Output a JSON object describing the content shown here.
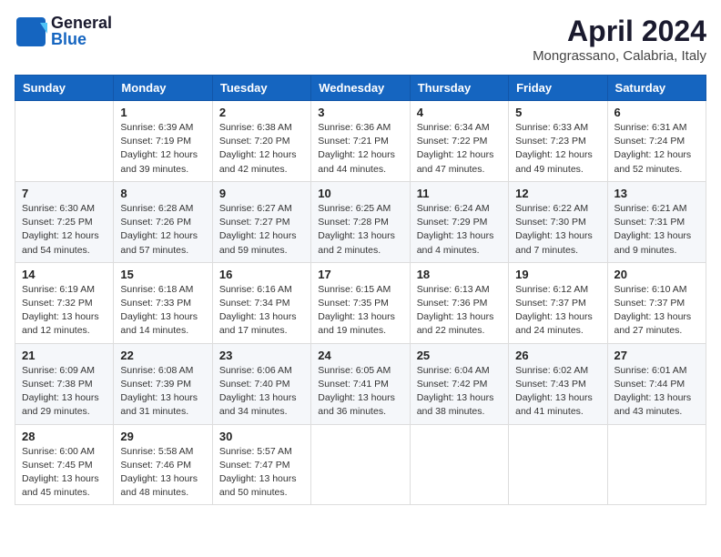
{
  "header": {
    "logo_line1": "General",
    "logo_line2": "Blue",
    "month": "April 2024",
    "location": "Mongrassano, Calabria, Italy"
  },
  "days_of_week": [
    "Sunday",
    "Monday",
    "Tuesday",
    "Wednesday",
    "Thursday",
    "Friday",
    "Saturday"
  ],
  "weeks": [
    [
      {
        "day": "",
        "info": ""
      },
      {
        "day": "1",
        "info": "Sunrise: 6:39 AM\nSunset: 7:19 PM\nDaylight: 12 hours\nand 39 minutes."
      },
      {
        "day": "2",
        "info": "Sunrise: 6:38 AM\nSunset: 7:20 PM\nDaylight: 12 hours\nand 42 minutes."
      },
      {
        "day": "3",
        "info": "Sunrise: 6:36 AM\nSunset: 7:21 PM\nDaylight: 12 hours\nand 44 minutes."
      },
      {
        "day": "4",
        "info": "Sunrise: 6:34 AM\nSunset: 7:22 PM\nDaylight: 12 hours\nand 47 minutes."
      },
      {
        "day": "5",
        "info": "Sunrise: 6:33 AM\nSunset: 7:23 PM\nDaylight: 12 hours\nand 49 minutes."
      },
      {
        "day": "6",
        "info": "Sunrise: 6:31 AM\nSunset: 7:24 PM\nDaylight: 12 hours\nand 52 minutes."
      }
    ],
    [
      {
        "day": "7",
        "info": "Sunrise: 6:30 AM\nSunset: 7:25 PM\nDaylight: 12 hours\nand 54 minutes."
      },
      {
        "day": "8",
        "info": "Sunrise: 6:28 AM\nSunset: 7:26 PM\nDaylight: 12 hours\nand 57 minutes."
      },
      {
        "day": "9",
        "info": "Sunrise: 6:27 AM\nSunset: 7:27 PM\nDaylight: 12 hours\nand 59 minutes."
      },
      {
        "day": "10",
        "info": "Sunrise: 6:25 AM\nSunset: 7:28 PM\nDaylight: 13 hours\nand 2 minutes."
      },
      {
        "day": "11",
        "info": "Sunrise: 6:24 AM\nSunset: 7:29 PM\nDaylight: 13 hours\nand 4 minutes."
      },
      {
        "day": "12",
        "info": "Sunrise: 6:22 AM\nSunset: 7:30 PM\nDaylight: 13 hours\nand 7 minutes."
      },
      {
        "day": "13",
        "info": "Sunrise: 6:21 AM\nSunset: 7:31 PM\nDaylight: 13 hours\nand 9 minutes."
      }
    ],
    [
      {
        "day": "14",
        "info": "Sunrise: 6:19 AM\nSunset: 7:32 PM\nDaylight: 13 hours\nand 12 minutes."
      },
      {
        "day": "15",
        "info": "Sunrise: 6:18 AM\nSunset: 7:33 PM\nDaylight: 13 hours\nand 14 minutes."
      },
      {
        "day": "16",
        "info": "Sunrise: 6:16 AM\nSunset: 7:34 PM\nDaylight: 13 hours\nand 17 minutes."
      },
      {
        "day": "17",
        "info": "Sunrise: 6:15 AM\nSunset: 7:35 PM\nDaylight: 13 hours\nand 19 minutes."
      },
      {
        "day": "18",
        "info": "Sunrise: 6:13 AM\nSunset: 7:36 PM\nDaylight: 13 hours\nand 22 minutes."
      },
      {
        "day": "19",
        "info": "Sunrise: 6:12 AM\nSunset: 7:37 PM\nDaylight: 13 hours\nand 24 minutes."
      },
      {
        "day": "20",
        "info": "Sunrise: 6:10 AM\nSunset: 7:37 PM\nDaylight: 13 hours\nand 27 minutes."
      }
    ],
    [
      {
        "day": "21",
        "info": "Sunrise: 6:09 AM\nSunset: 7:38 PM\nDaylight: 13 hours\nand 29 minutes."
      },
      {
        "day": "22",
        "info": "Sunrise: 6:08 AM\nSunset: 7:39 PM\nDaylight: 13 hours\nand 31 minutes."
      },
      {
        "day": "23",
        "info": "Sunrise: 6:06 AM\nSunset: 7:40 PM\nDaylight: 13 hours\nand 34 minutes."
      },
      {
        "day": "24",
        "info": "Sunrise: 6:05 AM\nSunset: 7:41 PM\nDaylight: 13 hours\nand 36 minutes."
      },
      {
        "day": "25",
        "info": "Sunrise: 6:04 AM\nSunset: 7:42 PM\nDaylight: 13 hours\nand 38 minutes."
      },
      {
        "day": "26",
        "info": "Sunrise: 6:02 AM\nSunset: 7:43 PM\nDaylight: 13 hours\nand 41 minutes."
      },
      {
        "day": "27",
        "info": "Sunrise: 6:01 AM\nSunset: 7:44 PM\nDaylight: 13 hours\nand 43 minutes."
      }
    ],
    [
      {
        "day": "28",
        "info": "Sunrise: 6:00 AM\nSunset: 7:45 PM\nDaylight: 13 hours\nand 45 minutes."
      },
      {
        "day": "29",
        "info": "Sunrise: 5:58 AM\nSunset: 7:46 PM\nDaylight: 13 hours\nand 48 minutes."
      },
      {
        "day": "30",
        "info": "Sunrise: 5:57 AM\nSunset: 7:47 PM\nDaylight: 13 hours\nand 50 minutes."
      },
      {
        "day": "",
        "info": ""
      },
      {
        "day": "",
        "info": ""
      },
      {
        "day": "",
        "info": ""
      },
      {
        "day": "",
        "info": ""
      }
    ]
  ]
}
